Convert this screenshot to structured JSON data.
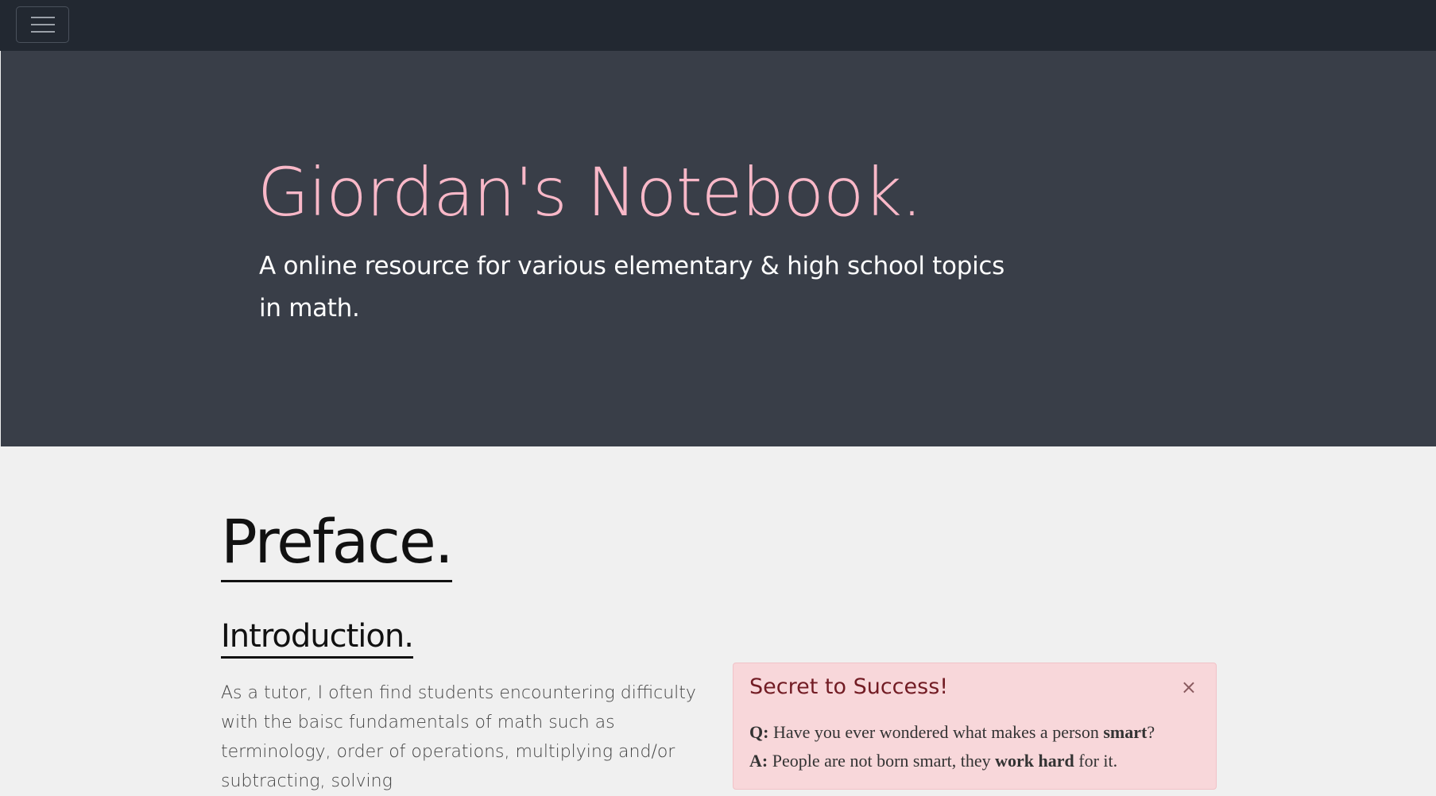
{
  "navbar": {
    "menu_icon": "hamburger-menu-icon",
    "background": "#222831"
  },
  "hero": {
    "title": "Giordan's Notebook.",
    "subtitle": "A online resource for various elementary & high school topics in math.",
    "title_color": "#f9b8c8",
    "background": "#393e48"
  },
  "content": {
    "preface_title": "Preface.",
    "intro_title": "Introduction.",
    "intro_paragraph": "As a tutor, I often find students encountering difficulty with the baisc fundamentals of math such as terminology, order of operations, multiplying and/or subtracting, solving"
  },
  "alert": {
    "title": "Secret to Success!",
    "close_label": "×",
    "q_label": "Q:",
    "q_text_1": " Have you ever wondered what makes a person ",
    "q_bold": "smart",
    "q_text_2": "?",
    "a_label": "A:",
    "a_text_1": " People are not born smart, they ",
    "a_bold": "work hard",
    "a_text_2": " for it.",
    "background": "#f8d7da",
    "title_color": "#721c24"
  }
}
